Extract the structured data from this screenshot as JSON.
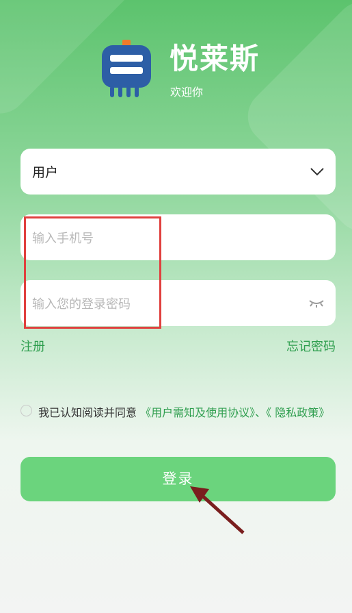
{
  "app": {
    "title": "悦莱斯",
    "subtitle": "欢迎你"
  },
  "role_select": {
    "value": "用户",
    "icon": "chevron-down-icon"
  },
  "phone_input": {
    "placeholder": "输入手机号",
    "value": ""
  },
  "password_input": {
    "placeholder": "输入您的登录密码",
    "value": "",
    "toggle_icon": "eye-closed-icon"
  },
  "links": {
    "register": "注册",
    "forgot_password": "忘记密码"
  },
  "agreement": {
    "prefix": "我已认知阅读并同意 ",
    "user_agreement": "《用户需知及使用协议》",
    "separator": "、",
    "privacy_policy": "《 隐私政策》",
    "checked": false
  },
  "login_button": {
    "label": "登录"
  },
  "colors": {
    "brand_green": "#6bd47d",
    "link_green": "#2e9e4e",
    "logo_blue": "#2d5ea6",
    "annotation_red": "#e0403e",
    "annotation_arrow": "#7a1e1e"
  }
}
